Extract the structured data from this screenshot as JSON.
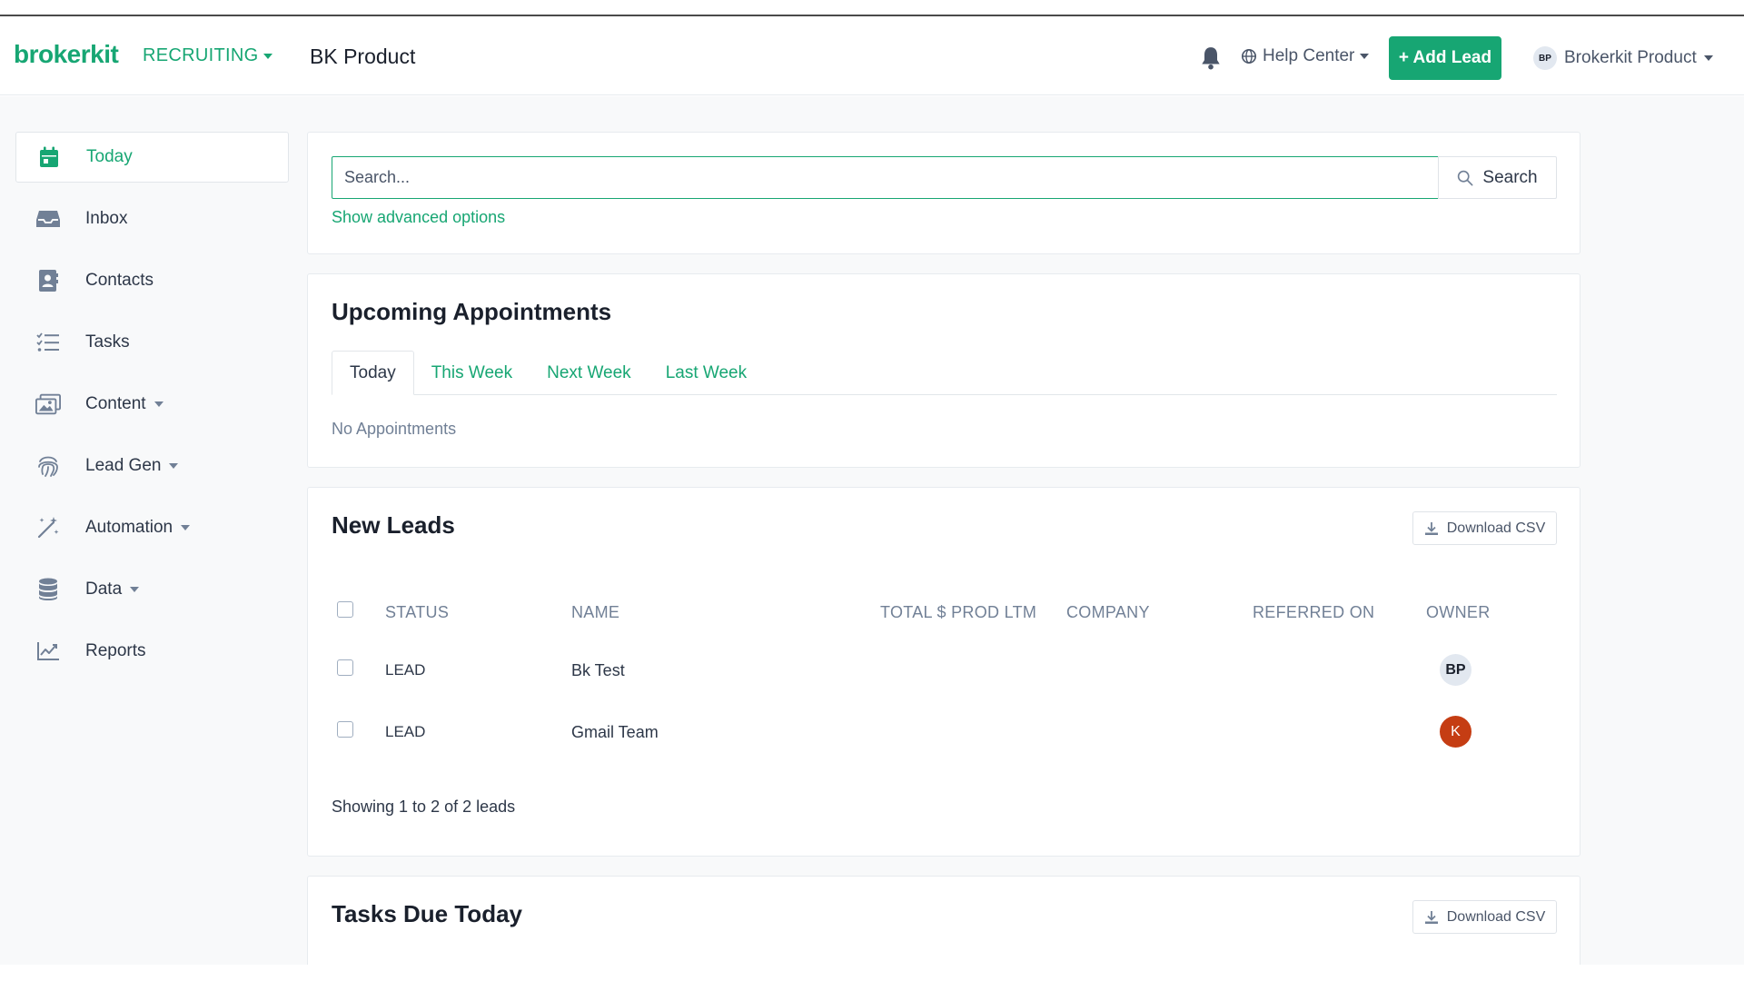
{
  "header": {
    "logo": "brokerkit",
    "module": "RECRUITING",
    "workspace": "BK Product",
    "help_label": "Help Center",
    "add_lead_label": "+ Add Lead",
    "user_initials": "BP",
    "user_name": "Brokerkit Product"
  },
  "sidebar": {
    "items": [
      {
        "label": "Today",
        "icon": "calendar-icon",
        "active": true
      },
      {
        "label": "Inbox",
        "icon": "inbox-icon"
      },
      {
        "label": "Contacts",
        "icon": "contacts-icon"
      },
      {
        "label": "Tasks",
        "icon": "tasks-icon"
      },
      {
        "label": "Content",
        "icon": "images-icon",
        "dropdown": true
      },
      {
        "label": "Lead Gen",
        "icon": "fingerprint-icon",
        "dropdown": true
      },
      {
        "label": "Automation",
        "icon": "magic-wand-icon",
        "dropdown": true
      },
      {
        "label": "Data",
        "icon": "database-icon",
        "dropdown": true
      },
      {
        "label": "Reports",
        "icon": "chart-line-icon"
      }
    ]
  },
  "search": {
    "placeholder": "Search...",
    "button_label": "Search",
    "advanced_link": "Show advanced options"
  },
  "appointments": {
    "title": "Upcoming Appointments",
    "tabs": [
      "Today",
      "This Week",
      "Next Week",
      "Last Week"
    ],
    "active_tab": "Today",
    "empty_text": "No Appointments"
  },
  "new_leads": {
    "title": "New Leads",
    "download_label": "Download CSV",
    "columns": [
      "STATUS",
      "NAME",
      "TOTAL $ PROD LTM",
      "COMPANY",
      "REFERRED ON",
      "OWNER"
    ],
    "rows": [
      {
        "status": "LEAD",
        "name": "Bk Test",
        "owner_initials": "BP",
        "owner_color": "#e2e8f0"
      },
      {
        "status": "LEAD",
        "name": "Gmail Team",
        "owner_initials": "K",
        "owner_color": "#c53d13"
      }
    ],
    "footer": "Showing 1 to 2 of 2 leads"
  },
  "tasks_due": {
    "title": "Tasks Due Today",
    "download_label": "Download CSV"
  },
  "colors": {
    "brand": "#17a673",
    "text": "#2d3748",
    "muted": "#718096",
    "background": "#f8f9fa"
  }
}
